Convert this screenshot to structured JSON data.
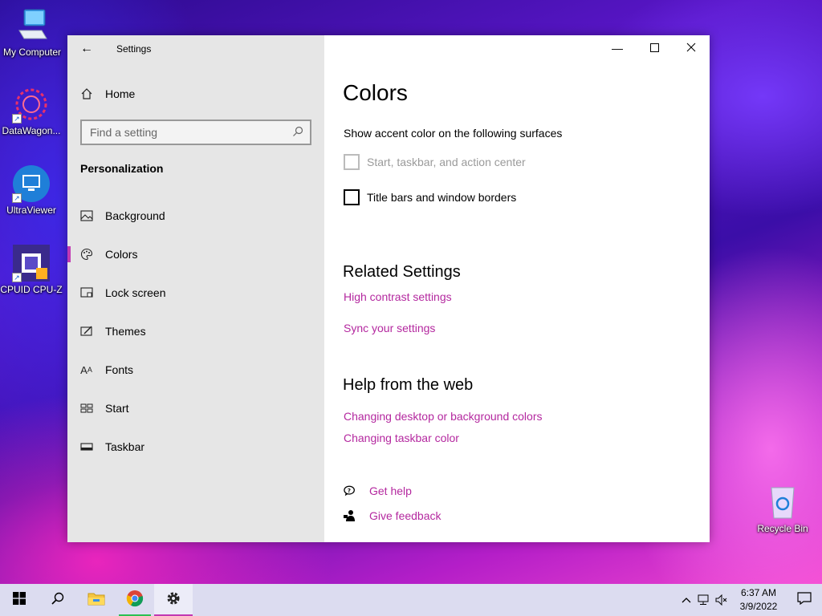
{
  "desktop": {
    "icons": [
      {
        "label": "My Computer",
        "icon": "computer-icon"
      },
      {
        "label": "DataWagon...",
        "icon": "datawagon-icon"
      },
      {
        "label": "UltraViewer",
        "icon": "ultraviewer-icon"
      },
      {
        "label": "CPUID CPU-Z",
        "icon": "cpuz-icon"
      },
      {
        "label": "Recycle Bin",
        "icon": "recycle-bin-icon"
      }
    ]
  },
  "window": {
    "app_title": "Settings",
    "back_icon": "arrow-left-icon",
    "controls": {
      "minimize": "minimize-icon",
      "maximize": "maximize-icon",
      "close": "close-icon"
    }
  },
  "sidebar": {
    "home_label": "Home",
    "search_placeholder": "Find a setting",
    "section_title": "Personalization",
    "items": [
      {
        "label": "Background",
        "icon": "picture-icon",
        "active": false
      },
      {
        "label": "Colors",
        "icon": "palette-icon",
        "active": true
      },
      {
        "label": "Lock screen",
        "icon": "lock-screen-icon",
        "active": false
      },
      {
        "label": "Themes",
        "icon": "themes-icon",
        "active": false
      },
      {
        "label": "Fonts",
        "icon": "fonts-icon",
        "active": false
      },
      {
        "label": "Start",
        "icon": "start-icon",
        "active": false
      },
      {
        "label": "Taskbar",
        "icon": "taskbar-icon",
        "active": false
      }
    ]
  },
  "content": {
    "title": "Colors",
    "accent_header": "Show accent color on the following surfaces",
    "checkboxes": [
      {
        "label": "Start, taskbar, and action center",
        "checked": false,
        "disabled": true
      },
      {
        "label": "Title bars and window borders",
        "checked": false,
        "disabled": false
      }
    ],
    "related_title": "Related Settings",
    "related_links": [
      "High contrast settings",
      "Sync your settings"
    ],
    "help_title": "Help from the web",
    "help_links": [
      "Changing desktop or background colors",
      "Changing taskbar color"
    ],
    "get_help": "Get help",
    "give_feedback": "Give feedback",
    "accent_color": "#b4289f"
  },
  "taskbar": {
    "apps": [
      "start-icon",
      "search-icon",
      "file-explorer-icon",
      "chrome-icon",
      "settings-icon"
    ],
    "clock_time": "6:37 AM",
    "clock_date": "3/9/2022"
  }
}
